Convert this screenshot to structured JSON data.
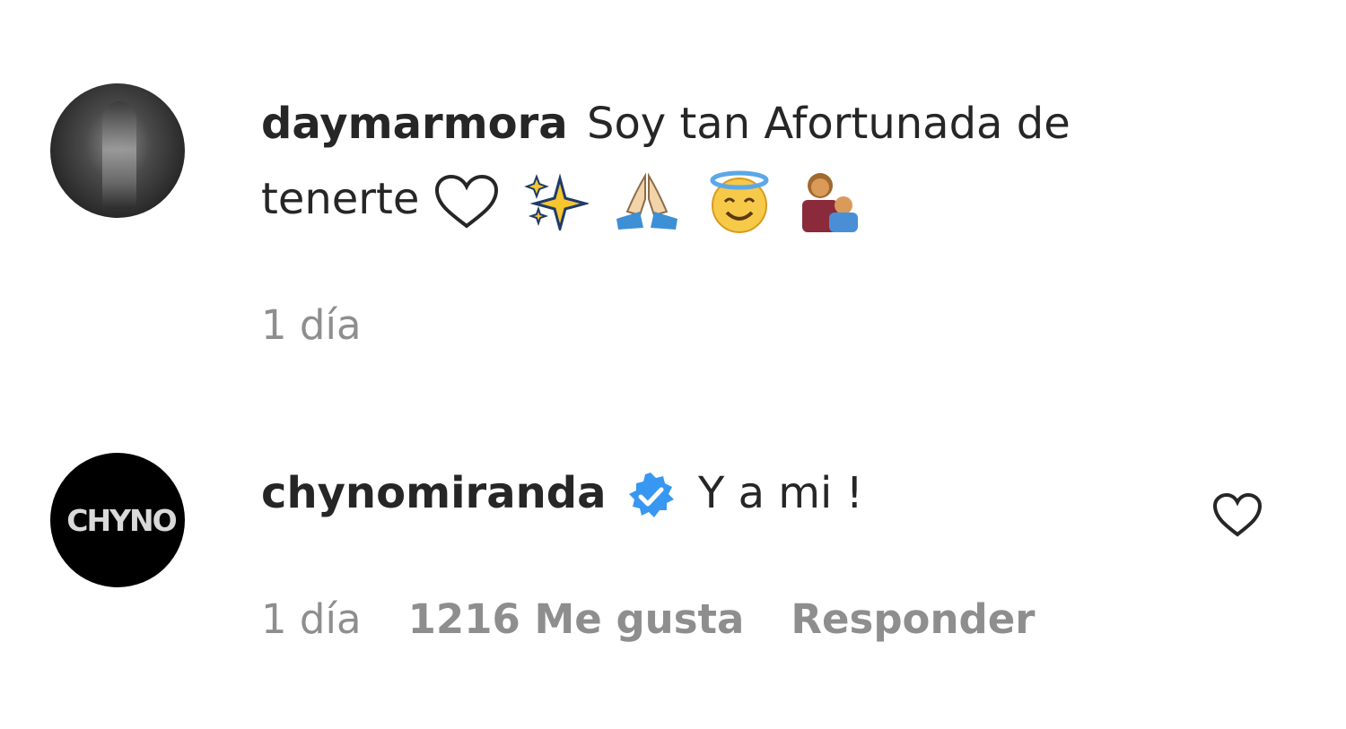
{
  "comments": [
    {
      "username": "daymarmora",
      "text_line1": "Soy tan Afortunada de",
      "text_line2": "tenerte",
      "emojis": [
        "white-heart-icon",
        "sparkles-icon",
        "folded-hands-icon",
        "smiling-face-with-halo-icon",
        "woman-and-baby-icon"
      ],
      "time": "1 día"
    },
    {
      "username": "chynomiranda",
      "verified": true,
      "avatar_text": "CHYNO",
      "text": "Y a mi !",
      "time": "1 día",
      "likes": "1216 Me gusta",
      "reply_label": "Responder"
    }
  ]
}
